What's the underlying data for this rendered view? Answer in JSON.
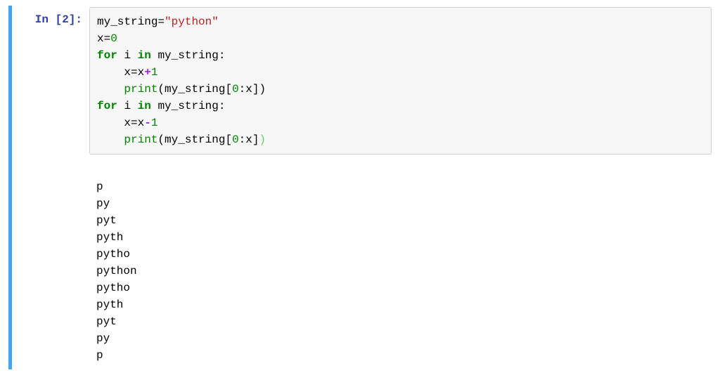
{
  "cell": {
    "prompt": "In [2]:",
    "code": {
      "line1": {
        "var": "my_string",
        "eq": "=",
        "str": "\"python\""
      },
      "line2": {
        "var": "x",
        "eq": "=",
        "num": "0"
      },
      "line3": {
        "for": "for",
        "i": "i",
        "in": "in",
        "var": "my_string",
        "colon": ":"
      },
      "line4": {
        "indent": "    ",
        "var": "x",
        "eq": "=",
        "var2": "x",
        "op": "+",
        "num": "1"
      },
      "line5": {
        "indent": "    ",
        "print": "print",
        "lp": "(",
        "var": "my_string",
        "lb": "[",
        "num": "0",
        "colon": ":",
        "var2": "x",
        "rb": "]",
        "rp": ")"
      },
      "line6": {
        "for": "for",
        "i": "i",
        "in": "in",
        "var": "my_string",
        "colon": ":"
      },
      "line7": {
        "indent": "    ",
        "var": "x",
        "eq": "=",
        "var2": "x",
        "op": "-",
        "num": "1"
      },
      "line8": {
        "indent": "    ",
        "print": "print",
        "lp": "(",
        "var": "my_string",
        "lb": "[",
        "num": "0",
        "colon": ":",
        "var2": "x",
        "rb": "]",
        "rp": ")"
      }
    },
    "output": "\np\npy\npyt\npyth\npytho\npython\npytho\npyth\npyt\npy\np"
  }
}
